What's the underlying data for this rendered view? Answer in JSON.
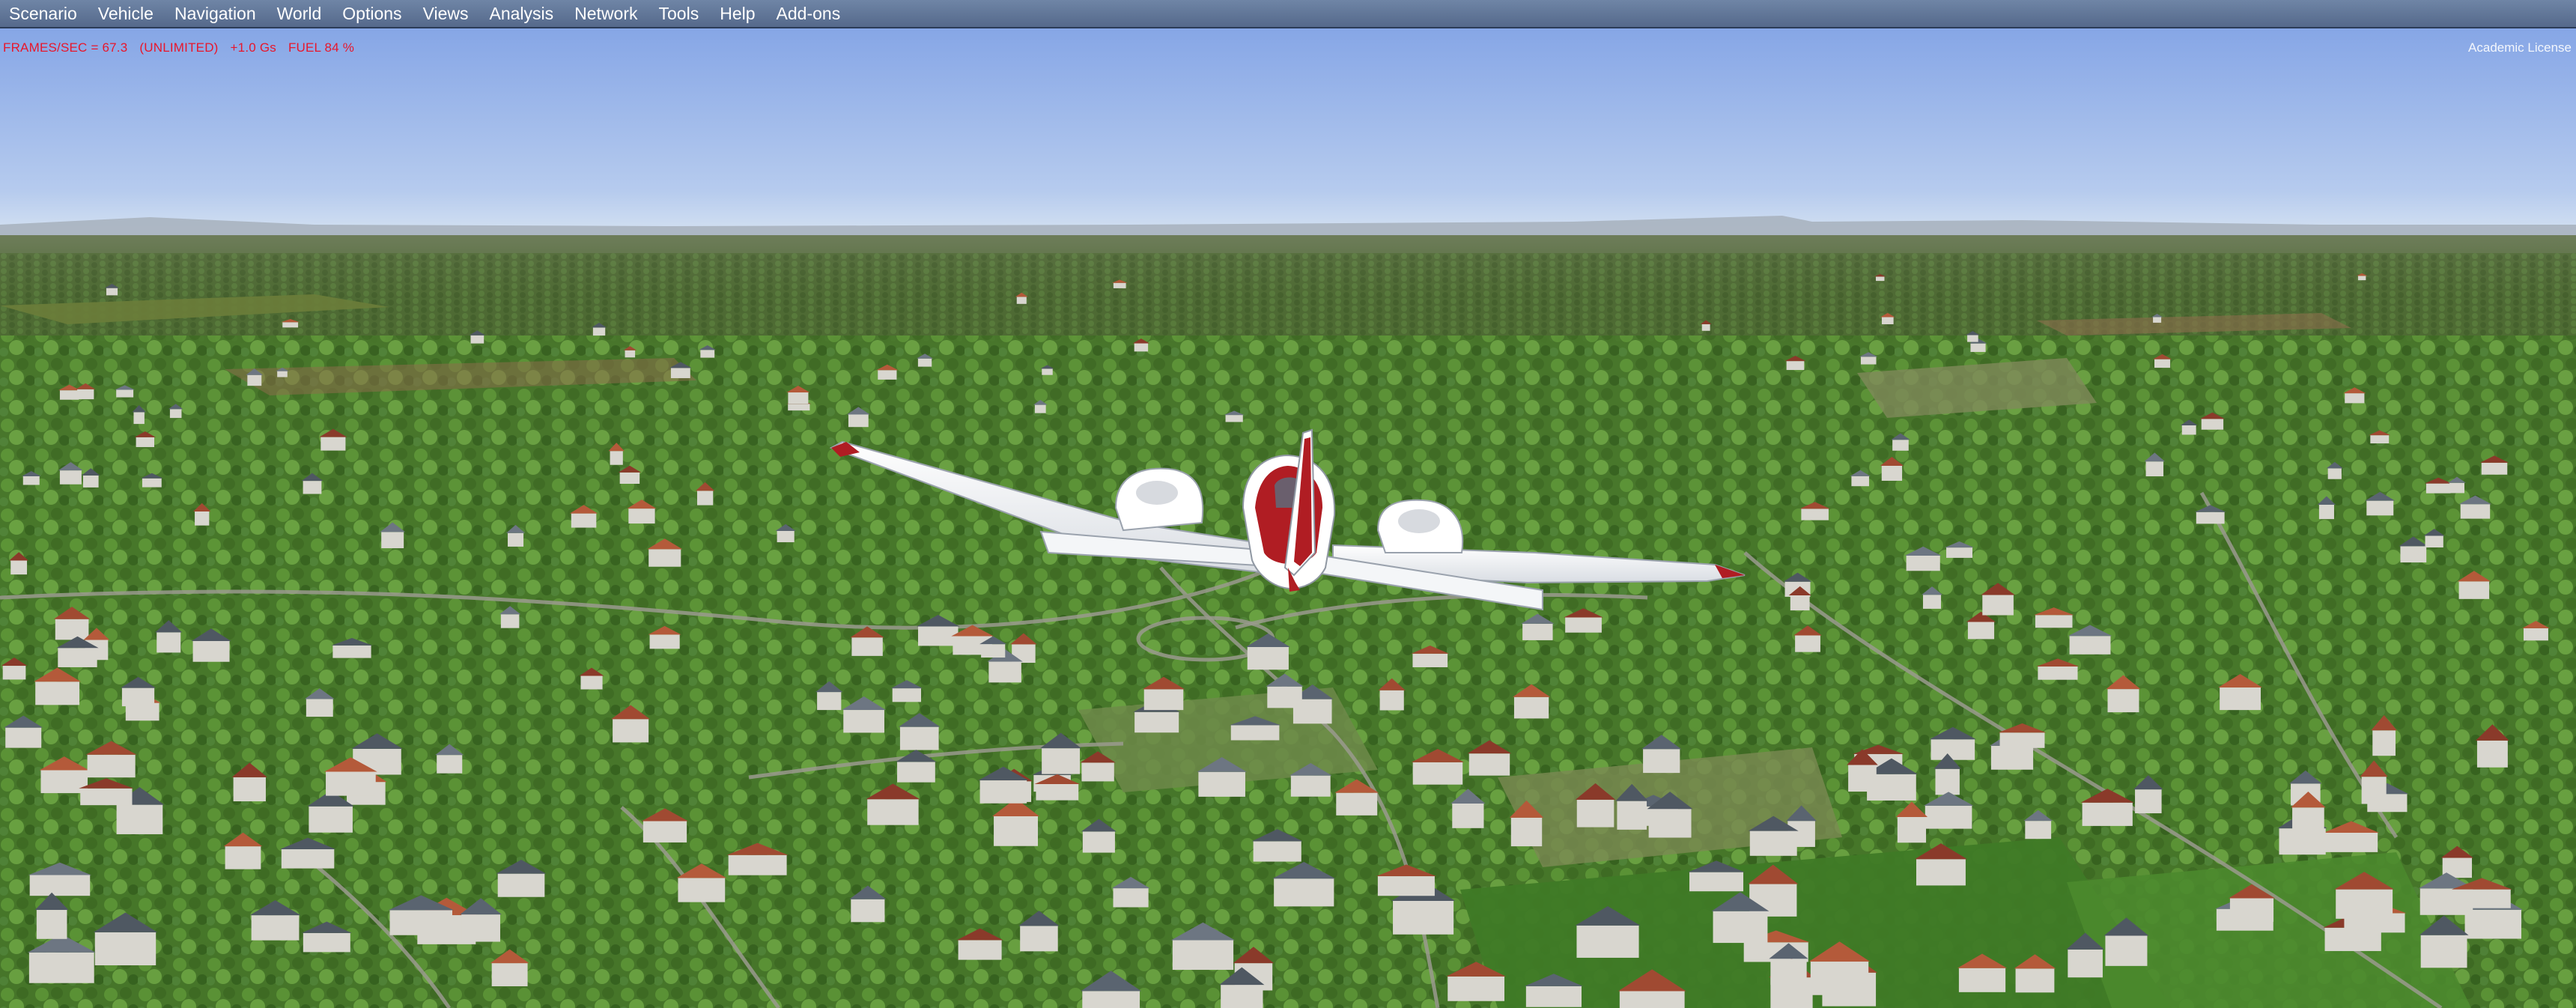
{
  "menu": {
    "items": [
      {
        "label": "Scenario",
        "name": "menu-scenario"
      },
      {
        "label": "Vehicle",
        "name": "menu-vehicle"
      },
      {
        "label": "Navigation",
        "name": "menu-navigation"
      },
      {
        "label": "World",
        "name": "menu-world"
      },
      {
        "label": "Options",
        "name": "menu-options"
      },
      {
        "label": "Views",
        "name": "menu-views"
      },
      {
        "label": "Analysis",
        "name": "menu-analysis"
      },
      {
        "label": "Network",
        "name": "menu-network"
      },
      {
        "label": "Tools",
        "name": "menu-tools"
      },
      {
        "label": "Help",
        "name": "menu-help"
      },
      {
        "label": "Add-ons",
        "name": "menu-addons"
      }
    ]
  },
  "hud": {
    "frames": "FRAMES/SEC = 67.3",
    "mode": "(UNLIMITED)",
    "gforce": "+1.0 Gs",
    "fuel": "FUEL 84 %"
  },
  "license": "Academic License",
  "colors": {
    "hud_text": "#e8162b",
    "menu_bar": "#607596",
    "sky_top": "#86a6e6",
    "sky_horizon": "#dce7f2",
    "aircraft_accent": "#b01d23"
  }
}
